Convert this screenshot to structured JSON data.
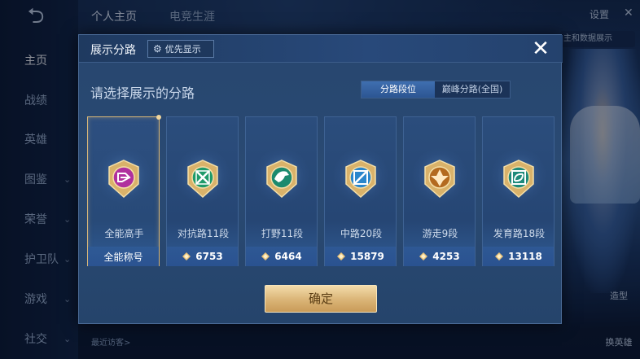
{
  "background": {
    "tabs": [
      "个人主页",
      "电竞生涯"
    ],
    "settings_label": "设置",
    "data_hint": "主和数据展示",
    "sidebar": [
      {
        "label": "主页",
        "active": true,
        "chevron": false
      },
      {
        "label": "战绩",
        "active": false,
        "chevron": false
      },
      {
        "label": "英雄",
        "active": false,
        "chevron": false
      },
      {
        "label": "图鉴",
        "active": false,
        "chevron": true
      },
      {
        "label": "荣誉",
        "active": false,
        "chevron": true
      },
      {
        "label": "护卫队",
        "active": false,
        "chevron": true
      },
      {
        "label": "游戏",
        "active": false,
        "chevron": true
      },
      {
        "label": "社交",
        "active": false,
        "chevron": true
      }
    ],
    "recent_visitors": "最近访客>",
    "right_buttons": [
      "造型",
      "换英雄"
    ]
  },
  "modal": {
    "title": "展示分路",
    "priority_label": "优先显示",
    "subtitle": "请选择展示的分路",
    "toggle": [
      {
        "label": "分路段位",
        "active": true
      },
      {
        "label": "巅峰分路(全国)",
        "active": false
      }
    ],
    "cards": [
      {
        "name": "全能高手",
        "footer": "全能称号",
        "points": "",
        "selected": true,
        "badge_color": "#b0309e",
        "badge_icon": "all-round-icon"
      },
      {
        "name": "对抗路11段",
        "footer": "",
        "points": "6753",
        "selected": false,
        "badge_color": "#1f9a6a",
        "badge_icon": "clash-lane-icon"
      },
      {
        "name": "打野11段",
        "footer": "",
        "points": "6464",
        "selected": false,
        "badge_color": "#1b8a6e",
        "badge_icon": "jungle-dragon-icon"
      },
      {
        "name": "中路20段",
        "footer": "",
        "points": "15879",
        "selected": false,
        "badge_color": "#2a86cc",
        "badge_icon": "mid-lane-icon"
      },
      {
        "name": "游走9段",
        "footer": "",
        "points": "4253",
        "selected": false,
        "badge_color": "#b36a20",
        "badge_icon": "roam-icon"
      },
      {
        "name": "发育路18段",
        "footer": "",
        "points": "13118",
        "selected": false,
        "badge_color": "#1f8a7a",
        "badge_icon": "farm-lane-icon"
      }
    ],
    "confirm_label": "确定"
  },
  "colors": {
    "accent_gold": "#dcb77a",
    "panel_blue": "#27466f",
    "selected_border": "#d9b778"
  }
}
